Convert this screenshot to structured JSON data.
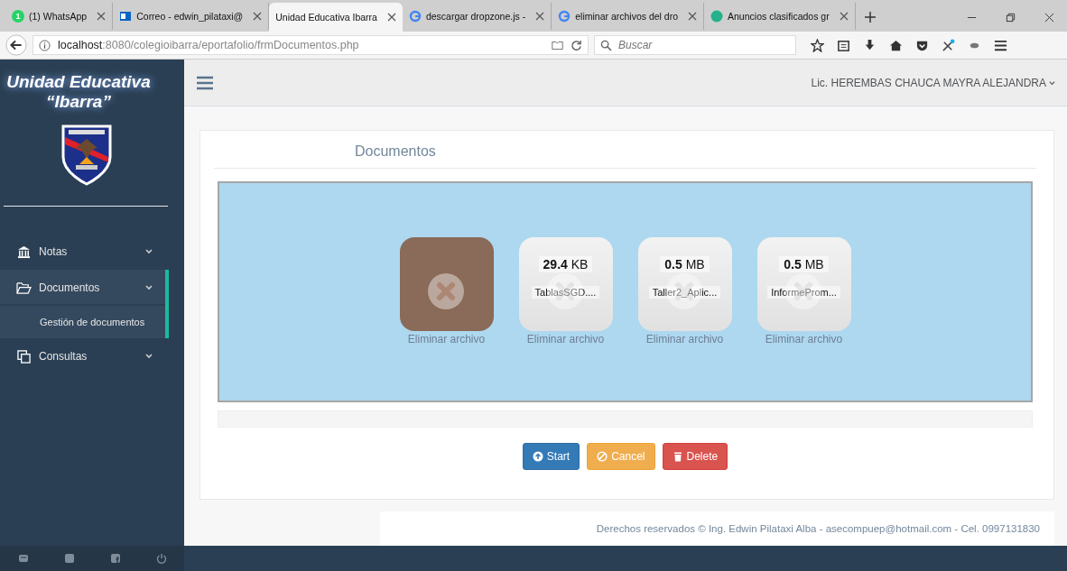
{
  "browser": {
    "tabs": [
      {
        "label": "(1) WhatsApp",
        "badge": "1",
        "selected": false
      },
      {
        "label": "Correo - edwin_pilataxi@",
        "selected": false
      },
      {
        "label": "Unidad Educativa Ibarra",
        "selected": true
      },
      {
        "label": "descargar dropzone.js -",
        "selected": false
      },
      {
        "label": "eliminar archivos del dro",
        "selected": false
      },
      {
        "label": "Anuncios clasificados gr",
        "selected": false
      }
    ],
    "url": {
      "host": "localhost",
      "path": ":8080/colegioibarra/eportafolio/frmDocumentos.php"
    },
    "search": {
      "placeholder": "Buscar"
    }
  },
  "sidebar": {
    "title": [
      "Unidad Educativa",
      "“Ibarra”"
    ],
    "menu": [
      {
        "label": "Notas",
        "selected": false
      },
      {
        "label": "Documentos",
        "selected": true,
        "children": [
          {
            "label": "Gestión de documentos"
          }
        ]
      },
      {
        "label": "Consultas",
        "selected": false
      }
    ]
  },
  "header": {
    "user": "Lic. HEREMBAS CHAUCA MAYRA ALEJANDRA"
  },
  "panel": {
    "title": "Documentos",
    "files": [
      {
        "kind": "image",
        "remove": "Eliminar archivo"
      },
      {
        "kind": "document",
        "size": "**29.4** KB",
        "name": "TablasSGD....",
        "remove": "Eliminar archivo"
      },
      {
        "kind": "document",
        "size": "**0.5** MB",
        "name": "Taller2_Aplic...",
        "remove": "Eliminar archivo"
      },
      {
        "kind": "document",
        "size": "**0.5** MB",
        "name": "InformeProm...",
        "remove": "Eliminar archivo"
      }
    ],
    "buttons": [
      {
        "label": "Start",
        "kind": "start"
      },
      {
        "label": "Cancel",
        "kind": "cancel"
      },
      {
        "label": "Delete",
        "kind": "delete"
      }
    ]
  },
  "footer": "Derechos reservados © Ing. Edwin Pilataxi Alba - asecompuep@hotmail.com - Cel. 0997131830"
}
